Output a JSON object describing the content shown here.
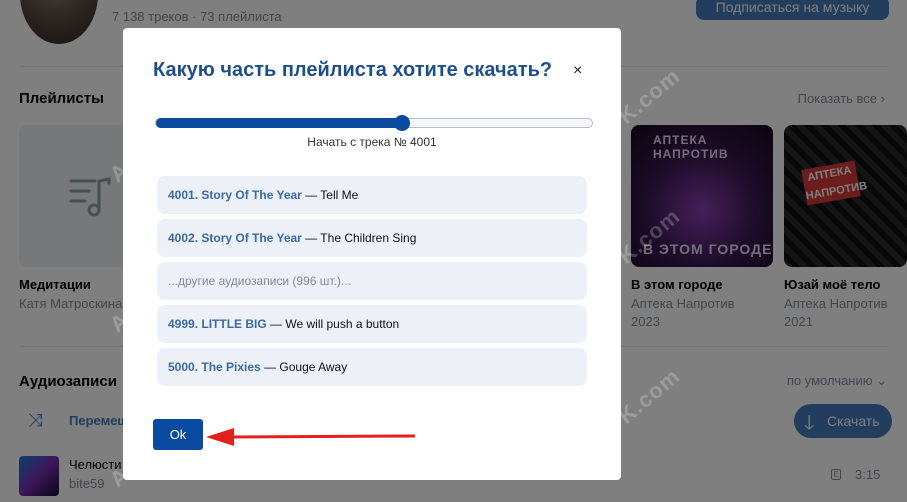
{
  "profile": {
    "stats": "7 138 треков · 73 плейлиста",
    "subscribe_label": "Подписаться на музыку"
  },
  "playlists": {
    "title": "Плейлисты",
    "show_all": "Показать все",
    "items": [
      {
        "title": "Медитации",
        "subtitle": "Катя Матроскина",
        "year": ""
      },
      {
        "title": "В этом городе",
        "subtitle": "Аптека Напротив",
        "year": "2023"
      },
      {
        "title": "Юзай моё тело",
        "subtitle": "Аптека Напротив",
        "year": "2021"
      }
    ]
  },
  "audio": {
    "title": "Аудиозаписи",
    "shuffle_label": "Перемеш",
    "sort_label": "по умолчанию",
    "download_label": "Скачать",
    "track": {
      "title": "Челюсти",
      "artist": "bite59",
      "duration": "3:15",
      "explicit": "E"
    }
  },
  "watermark": "AudioVK.com",
  "modal": {
    "title": "Какую часть плейлиста хотите скачать?",
    "close_symbol": "×",
    "slider_fraction": 0.565,
    "slider_caption": "Начать с трека № 4001",
    "tracks": [
      {
        "num": "4001. Story Of The Year",
        "rest": " — Tell Me"
      },
      {
        "num": "4002. Story Of The Year",
        "rest": " — The Children Sing"
      },
      {
        "more": "...другие аудиозаписи (996 шт.)..."
      },
      {
        "num": "4999. LITTLE BIG",
        "rest": " — We will push a button"
      },
      {
        "num": "5000. The Pixies",
        "rest": " — Gouge Away"
      }
    ],
    "ok_label": "Ok"
  },
  "colors": {
    "accent": "#0a4aa0",
    "arrow": "#e3201b",
    "link": "#3a6aa6"
  }
}
